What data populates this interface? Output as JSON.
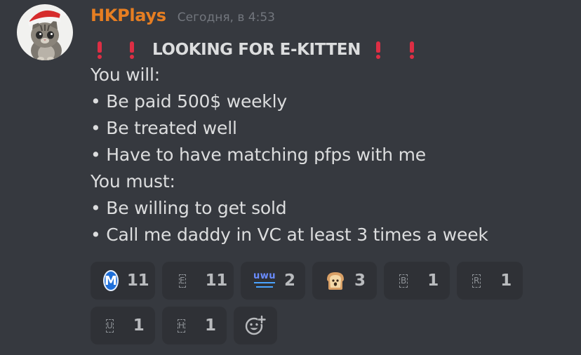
{
  "message": {
    "username": "HKPlays",
    "username_color": "#e67e22",
    "timestamp": "Сегодня, в 4:53",
    "avatar_icon": "kitten-santa-hat-avatar",
    "title": "LOOKING FOR E-KITTEN",
    "title_emoji": "heavy-exclamation-mark-icon",
    "lines": [
      "You will:",
      "• Be paid 500$ weekly",
      "• Be treated well",
      "• Have to have matching pfps with me",
      "You must:",
      "• Be willing to get sold",
      "• Call me daddy in VC at least 3 times a week"
    ]
  },
  "reactions": [
    {
      "emoji": "M",
      "icon": "m-circle-icon",
      "count": "11"
    },
    {
      "emoji": "E",
      "icon": "letter-e-icon",
      "count": "11"
    },
    {
      "emoji": "uwu",
      "icon": "uwu-icon",
      "count": "2"
    },
    {
      "emoji": "bread",
      "icon": "bread-face-icon",
      "count": "3"
    },
    {
      "emoji": "B",
      "icon": "letter-b-icon",
      "count": "1"
    },
    {
      "emoji": "R",
      "icon": "letter-r-icon",
      "count": "1"
    },
    {
      "emoji": "U",
      "icon": "letter-u-icon",
      "count": "1"
    },
    {
      "emoji": "H",
      "icon": "letter-h-icon",
      "count": "1"
    }
  ],
  "add_reaction_icon": "add-reaction-icon"
}
